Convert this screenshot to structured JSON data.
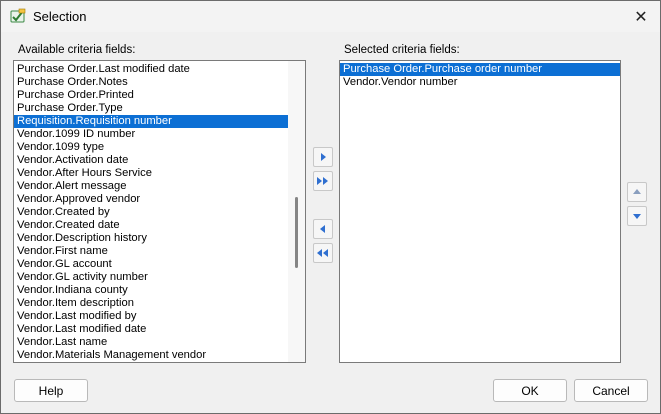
{
  "window": {
    "title": "Selection"
  },
  "available": {
    "label": "Available criteria fields:",
    "items": [
      "Purchase Order.Last modified date",
      "Purchase Order.Notes",
      "Purchase Order.Printed",
      "Purchase Order.Type",
      "Requisition.Requisition number",
      "Vendor.1099 ID number",
      "Vendor.1099 type",
      "Vendor.Activation date",
      "Vendor.After Hours Service",
      "Vendor.Alert message",
      "Vendor.Approved vendor",
      "Vendor.Created by",
      "Vendor.Created date",
      "Vendor.Description history",
      "Vendor.First name",
      "Vendor.GL account",
      "Vendor.GL activity number",
      "Vendor.Indiana county",
      "Vendor.Item description",
      "Vendor.Last modified by",
      "Vendor.Last modified date",
      "Vendor.Last name",
      "Vendor.Materials Management vendor"
    ],
    "selected_index": 4
  },
  "selected": {
    "label": "Selected criteria fields:",
    "items": [
      "Purchase Order.Purchase order number",
      "Vendor.Vendor number"
    ],
    "selected_index": 0
  },
  "buttons": {
    "help": "Help",
    "ok": "OK",
    "cancel": "Cancel"
  },
  "colors": {
    "selection": "#0c6fd4",
    "arrow_blue": "#2f6fd0"
  }
}
